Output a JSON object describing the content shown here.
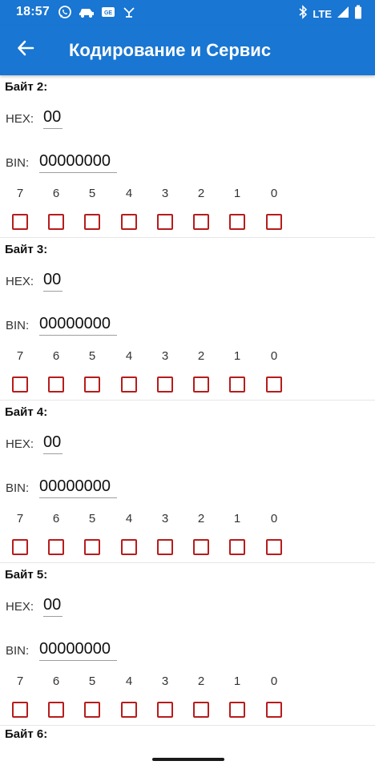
{
  "status_bar": {
    "time": "18:57",
    "network": "LTE",
    "left_icons": [
      "whatsapp-icon",
      "car-icon",
      "ge-icon",
      "swap-icon"
    ],
    "right_icons": [
      "bluetooth-icon",
      "signal-icon",
      "battery-icon"
    ]
  },
  "app_bar": {
    "title": "Кодирование и Сервис",
    "back_icon": "arrow-left-icon",
    "color": "#1976D2"
  },
  "labels": {
    "hex": "HEX:",
    "bin": "BIN:"
  },
  "bit_numbers": [
    "7",
    "6",
    "5",
    "4",
    "3",
    "2",
    "1",
    "0"
  ],
  "checkbox_color": "#B71C1C",
  "bytes": [
    {
      "title": "Байт 2:",
      "hex": "00",
      "bin": "00000000"
    },
    {
      "title": "Байт 3:",
      "hex": "00",
      "bin": "00000000"
    },
    {
      "title": "Байт 4:",
      "hex": "00",
      "bin": "00000000"
    },
    {
      "title": "Байт 5:",
      "hex": "00",
      "bin": "00000000"
    }
  ],
  "next_byte_title": "Байт 6:"
}
